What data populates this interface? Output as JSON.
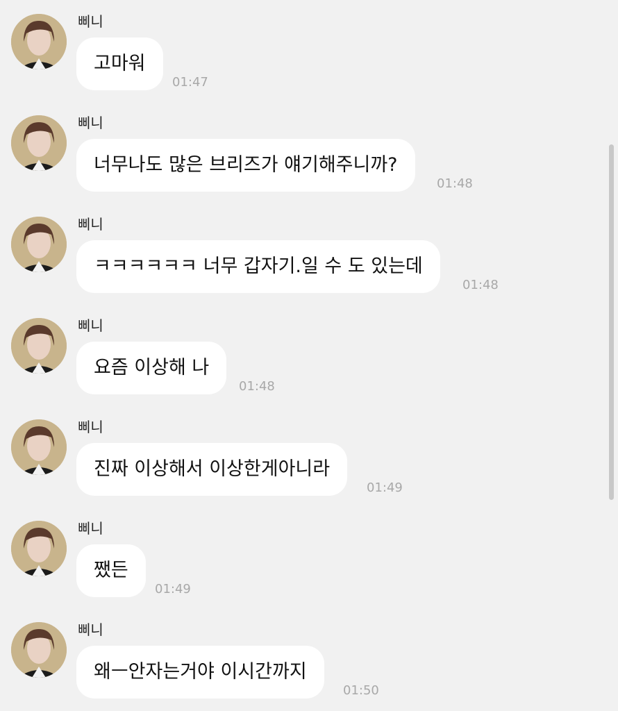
{
  "chat": {
    "messages": [
      {
        "sender": "삐니",
        "text": "고마워",
        "time": "01:47"
      },
      {
        "sender": "삐니",
        "text": "너무나도 많은 브리즈가 얘기해주니까?",
        "time": "01:48"
      },
      {
        "sender": "삐니",
        "text": "ㅋㅋㅋㅋㅋㅋ 너무 갑자기.일 수 도 있는데",
        "time": "01:48"
      },
      {
        "sender": "삐니",
        "text": "요즘 이상해 나",
        "time": "01:48"
      },
      {
        "sender": "삐니",
        "text": "진짜 이상해서 이상한게아니라",
        "time": "01:49"
      },
      {
        "sender": "삐니",
        "text": "쨌든",
        "time": "01:49"
      },
      {
        "sender": "삐니",
        "text": "왜ㅡ안자는거야 이시간까지",
        "time": "01:50"
      }
    ]
  },
  "icons": {
    "avatar": "profile-avatar-icon"
  },
  "colors": {
    "background": "#f1f1f1",
    "bubble": "#ffffff",
    "time": "#a8a8a8"
  }
}
